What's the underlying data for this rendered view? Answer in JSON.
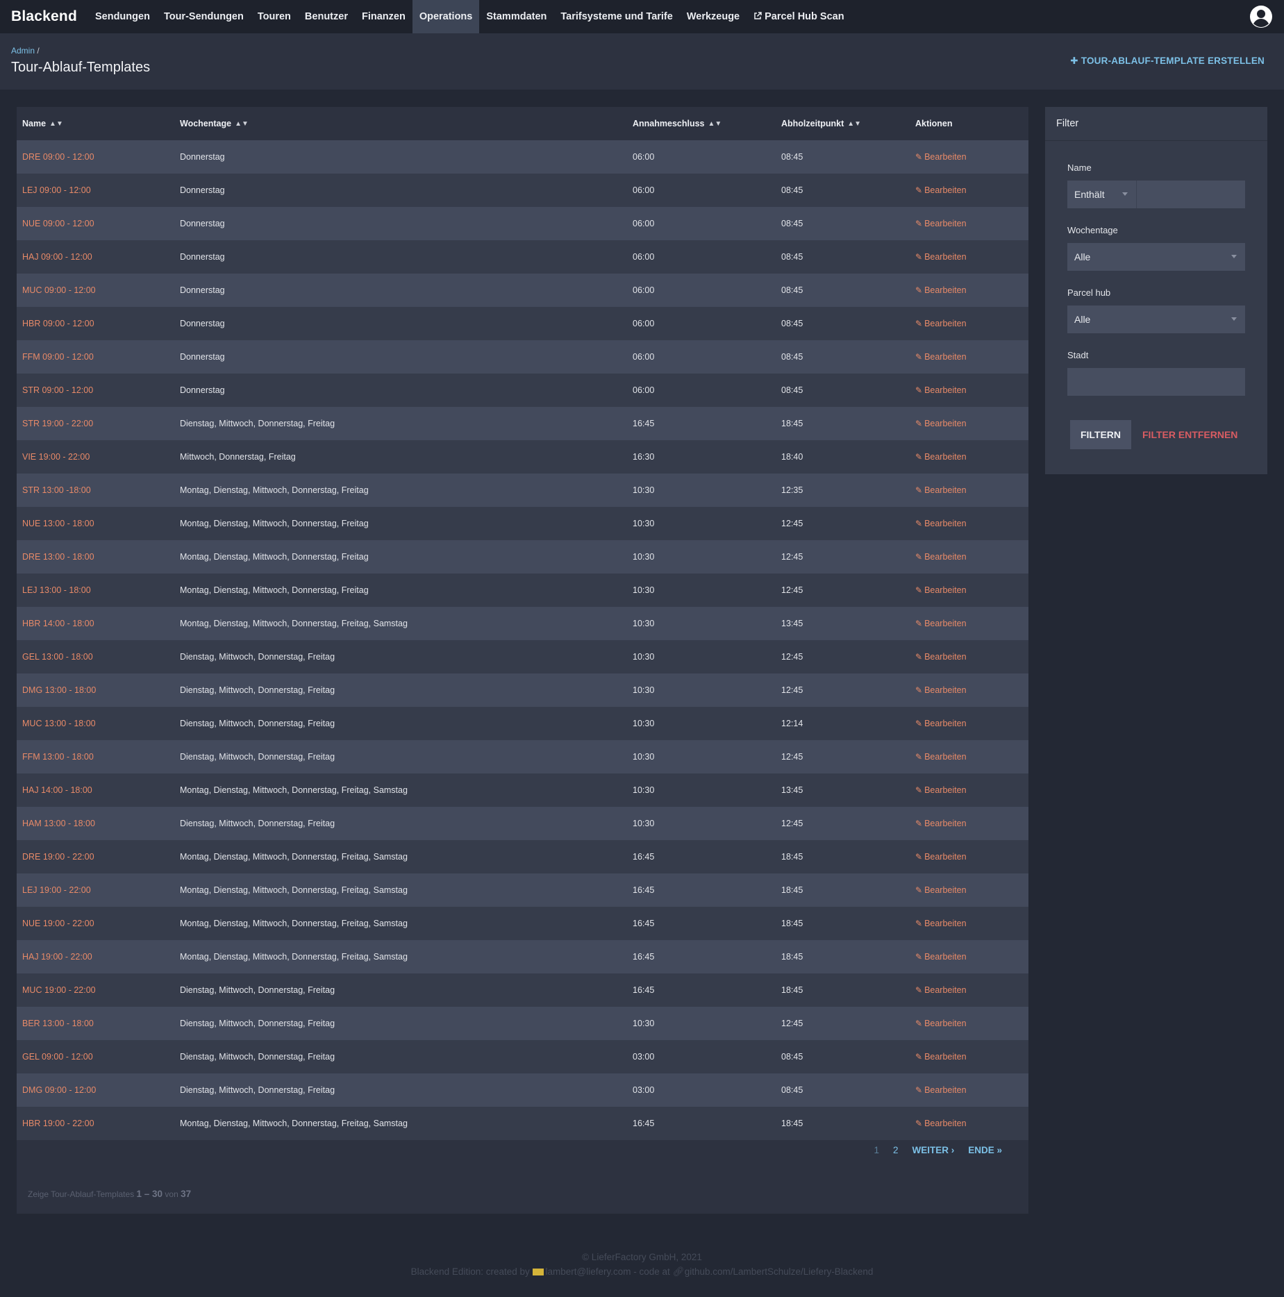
{
  "navbar": {
    "brand": "Blackend",
    "items": [
      "Sendungen",
      "Tour-Sendungen",
      "Touren",
      "Benutzer",
      "Finanzen",
      "Operations",
      "Stammdaten",
      "Tarifsysteme und Tarife",
      "Werkzeuge",
      "Parcel Hub Scan"
    ],
    "active": "Operations"
  },
  "header": {
    "breadcrumb_link": "Admin",
    "breadcrumb_sep": "/",
    "title": "Tour-Ablauf-Templates",
    "create_label": "TOUR-ABLAUF-TEMPLATE ERSTELLEN"
  },
  "table": {
    "columns": [
      "Name",
      "Wochentage",
      "Annahmeschluss",
      "Abholzeitpunkt",
      "Aktionen"
    ],
    "action_label": "Bearbeiten",
    "rows": [
      [
        "DRE 09:00 - 12:00",
        "Donnerstag",
        "06:00",
        "08:45"
      ],
      [
        "LEJ 09:00 - 12:00",
        "Donnerstag",
        "06:00",
        "08:45"
      ],
      [
        "NUE 09:00 - 12:00",
        "Donnerstag",
        "06:00",
        "08:45"
      ],
      [
        "HAJ 09:00 - 12:00",
        "Donnerstag",
        "06:00",
        "08:45"
      ],
      [
        "MUC 09:00 - 12:00",
        "Donnerstag",
        "06:00",
        "08:45"
      ],
      [
        "HBR 09:00 - 12:00",
        "Donnerstag",
        "06:00",
        "08:45"
      ],
      [
        "FFM 09:00 - 12:00",
        "Donnerstag",
        "06:00",
        "08:45"
      ],
      [
        "STR 09:00 - 12:00",
        "Donnerstag",
        "06:00",
        "08:45"
      ],
      [
        "STR 19:00 - 22:00",
        "Dienstag, Mittwoch, Donnerstag, Freitag",
        "16:45",
        "18:45"
      ],
      [
        "VIE 19:00 - 22:00",
        "Mittwoch, Donnerstag, Freitag",
        "16:30",
        "18:40"
      ],
      [
        "STR 13:00 -18:00",
        "Montag, Dienstag, Mittwoch, Donnerstag, Freitag",
        "10:30",
        "12:35"
      ],
      [
        "NUE 13:00 - 18:00",
        "Montag, Dienstag, Mittwoch, Donnerstag, Freitag",
        "10:30",
        "12:45"
      ],
      [
        "DRE 13:00 - 18:00",
        "Montag, Dienstag, Mittwoch, Donnerstag, Freitag",
        "10:30",
        "12:45"
      ],
      [
        "LEJ 13:00 - 18:00",
        "Montag, Dienstag, Mittwoch, Donnerstag, Freitag",
        "10:30",
        "12:45"
      ],
      [
        "HBR 14:00 - 18:00",
        "Montag, Dienstag, Mittwoch, Donnerstag, Freitag, Samstag",
        "10:30",
        "13:45"
      ],
      [
        "GEL 13:00 - 18:00",
        "Dienstag, Mittwoch, Donnerstag, Freitag",
        "10:30",
        "12:45"
      ],
      [
        "DMG 13:00 - 18:00",
        "Dienstag, Mittwoch, Donnerstag, Freitag",
        "10:30",
        "12:45"
      ],
      [
        "MUC 13:00 - 18:00",
        "Dienstag, Mittwoch, Donnerstag, Freitag",
        "10:30",
        "12:14"
      ],
      [
        "FFM 13:00 - 18:00",
        "Dienstag, Mittwoch, Donnerstag, Freitag",
        "10:30",
        "12:45"
      ],
      [
        "HAJ 14:00 - 18:00",
        "Montag, Dienstag, Mittwoch, Donnerstag, Freitag, Samstag",
        "10:30",
        "13:45"
      ],
      [
        "HAM 13:00 - 18:00",
        "Dienstag, Mittwoch, Donnerstag, Freitag",
        "10:30",
        "12:45"
      ],
      [
        "DRE 19:00 - 22:00",
        "Montag, Dienstag, Mittwoch, Donnerstag, Freitag, Samstag",
        "16:45",
        "18:45"
      ],
      [
        "LEJ 19:00 - 22:00",
        "Montag, Dienstag, Mittwoch, Donnerstag, Freitag, Samstag",
        "16:45",
        "18:45"
      ],
      [
        "NUE 19:00 - 22:00",
        "Montag, Dienstag, Mittwoch, Donnerstag, Freitag, Samstag",
        "16:45",
        "18:45"
      ],
      [
        "HAJ 19:00 - 22:00",
        "Montag, Dienstag, Mittwoch, Donnerstag, Freitag, Samstag",
        "16:45",
        "18:45"
      ],
      [
        "MUC 19:00 - 22:00",
        "Dienstag, Mittwoch, Donnerstag, Freitag",
        "16:45",
        "18:45"
      ],
      [
        "BER 13:00 - 18:00",
        "Dienstag, Mittwoch, Donnerstag, Freitag",
        "10:30",
        "12:45"
      ],
      [
        "GEL 09:00 - 12:00",
        "Dienstag, Mittwoch, Donnerstag, Freitag",
        "03:00",
        "08:45"
      ],
      [
        "DMG 09:00 - 12:00",
        "Dienstag, Mittwoch, Donnerstag, Freitag",
        "03:00",
        "08:45"
      ],
      [
        "HBR 19:00 - 22:00",
        "Montag, Dienstag, Mittwoch, Donnerstag, Freitag, Samstag",
        "16:45",
        "18:45"
      ]
    ]
  },
  "pagination": {
    "current": "1",
    "page2": "2",
    "next": "WEITER ›",
    "end": "ENDE »"
  },
  "summary": {
    "prefix": "Zeige Tour-Ablauf-Templates",
    "range": "1 – 30",
    "of": "von",
    "total": "37"
  },
  "filter": {
    "title": "Filter",
    "name_label": "Name",
    "name_mode": "Enthält",
    "name_value": "",
    "weekdays_label": "Wochentage",
    "weekdays_value": "Alle",
    "hub_label": "Parcel hub",
    "hub_value": "Alle",
    "city_label": "Stadt",
    "city_value": "",
    "apply_label": "FILTERN",
    "clear_label": "FILTER ENTFERNEN"
  },
  "footer": {
    "line1": "© LieferFactory GmbH, 2021",
    "line2_prefix": "Blackend Edition: created by",
    "email": "lambert@liefery.com",
    "line2_mid": "- code at",
    "repo": "github.com/LambertSchulze/Liefery-Blackend"
  },
  "colors": {
    "background": "#232834",
    "accent_link": "#7cc0e6",
    "name_link": "#e88a68",
    "danger": "#d95c62"
  }
}
